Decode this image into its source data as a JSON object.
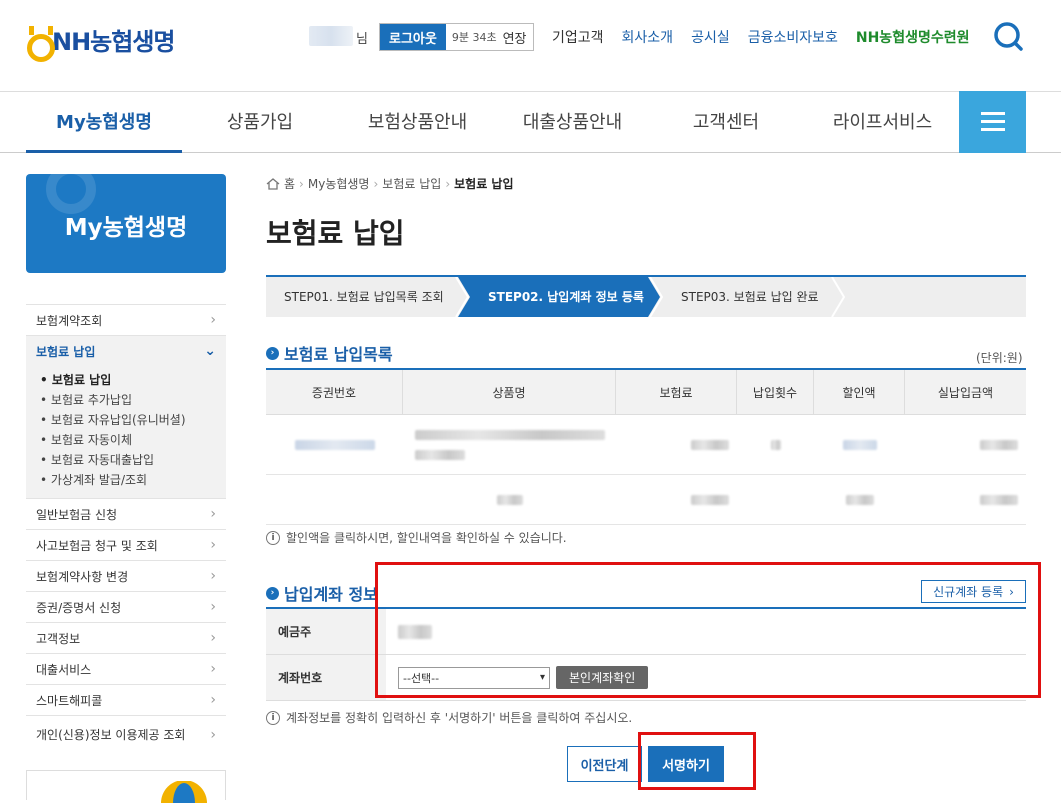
{
  "header": {
    "logo_text": "NH농협생명",
    "user_suffix": "님",
    "logout_label": "로그아웃",
    "timer": "9분 34초",
    "extend_label": "연장",
    "links": [
      "기업고객",
      "회사소개",
      "공시실",
      "금융소비자보호"
    ],
    "highlight_link": "NH농협생명수련원"
  },
  "gnb": {
    "items": [
      "My농협생명",
      "상품가입",
      "보험상품안내",
      "대출상품안내",
      "고객센터",
      "라이프서비스"
    ]
  },
  "sidebar": {
    "banner_title": "My농협생명",
    "items": [
      "보험계약조회",
      "보험료 납입",
      "일반보험금 신청",
      "사고보험금 청구 및 조회",
      "보험계약사항 변경",
      "증권/증명서 신청",
      "고객정보",
      "대출서비스",
      "스마트해피콜",
      "개인(신용)정보 이용제공 조회"
    ],
    "sub_items": [
      "보험료 납입",
      "보험료 추가납입",
      "보험료 자유납입(유니버셜)",
      "보험료 자동이체",
      "보험료 자동대출납입",
      "가상계좌 발급/조회"
    ]
  },
  "breadcrumb": [
    "홈",
    "My농협생명",
    "보험료 납입",
    "보험료 납입"
  ],
  "page_title": "보험료 납입",
  "steps": [
    "STEP01. 보험료 납입목록 조회",
    "STEP02. 납입계좌 정보 등록",
    "STEP03. 보험료 납입 완료"
  ],
  "list_section": {
    "title": "보험료 납입목록",
    "unit": "(단위:원)",
    "columns": [
      "증권번호",
      "상품명",
      "보험료",
      "납입횟수",
      "할인액",
      "실납입금액"
    ],
    "note": "할인액을 클릭하시면, 할인내역을 확인하실 수 있습니다."
  },
  "account_section": {
    "title": "납입계좌 정보",
    "new_account_label": "신규계좌 등록",
    "depositor_label": "예금주",
    "account_label": "계좌번호",
    "select_value": "--선택--",
    "verify_label": "본인계좌확인",
    "note": "계좌정보를 정확히 입력하신 후 '서명하기' 버튼을 클릭하여 주십시오."
  },
  "buttons": {
    "prev": "이전단계",
    "sign": "서명하기"
  }
}
